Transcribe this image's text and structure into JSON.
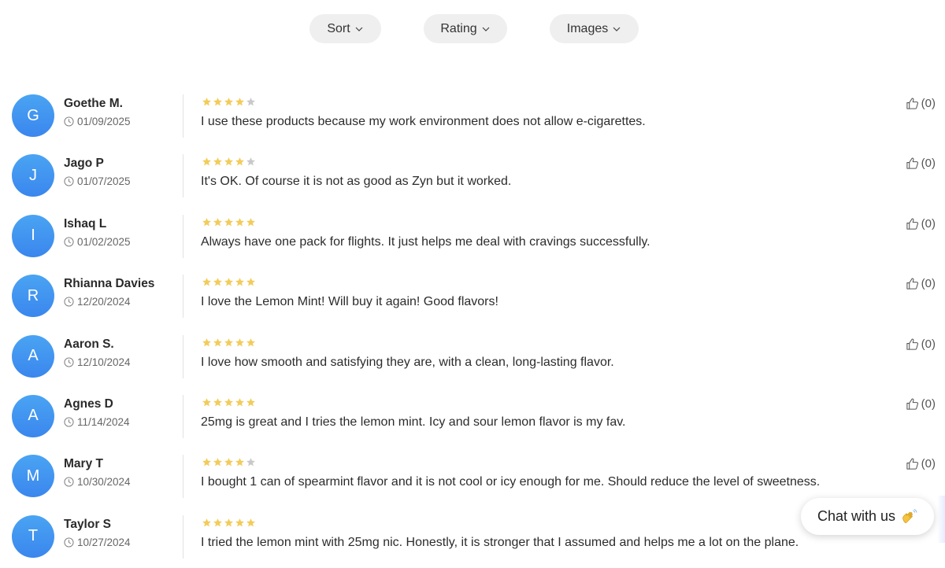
{
  "filters": {
    "sort_label": "Sort",
    "rating_label": "Rating",
    "images_label": "Images"
  },
  "colors": {
    "star_filled": "#f2cc5b",
    "star_empty": "#c9c9c9",
    "avatar_gradient_top": "#4aa4f2",
    "avatar_gradient_bottom": "#3a86ee"
  },
  "reviews": [
    {
      "initial": "G",
      "name": "Goethe M.",
      "date": "01/09/2025",
      "rating": 4,
      "text": "I use these products because my work environment does not allow e-cigarettes.",
      "likes": "(0)"
    },
    {
      "initial": "J",
      "name": "Jago P",
      "date": "01/07/2025",
      "rating": 4,
      "text": "It's OK. Of course it is not as good as Zyn but it worked.",
      "likes": "(0)"
    },
    {
      "initial": "I",
      "name": "Ishaq L",
      "date": "01/02/2025",
      "rating": 5,
      "text": "Always have one pack for flights. It just helps me deal with cravings successfully.",
      "likes": "(0)"
    },
    {
      "initial": "R",
      "name": "Rhianna Davies",
      "date": "12/20/2024",
      "rating": 5,
      "text": "I love the Lemon Mint! Will buy it again! Good flavors!",
      "likes": "(0)"
    },
    {
      "initial": "A",
      "name": "Aaron S.",
      "date": "12/10/2024",
      "rating": 5,
      "text": "I love how smooth and satisfying they are, with a clean, long-lasting flavor.",
      "likes": "(0)"
    },
    {
      "initial": "A",
      "name": "Agnes D",
      "date": "11/14/2024",
      "rating": 5,
      "text": "25mg is great and I tries the lemon mint. Icy and sour lemon flavor is my fav.",
      "likes": "(0)"
    },
    {
      "initial": "M",
      "name": "Mary T",
      "date": "10/30/2024",
      "rating": 4,
      "text": "I bought 1 can of spearmint flavor and it is not cool or icy enough for me. Should reduce the level of sweetness.",
      "likes": "(0)"
    },
    {
      "initial": "T",
      "name": "Taylor S",
      "date": "10/27/2024",
      "rating": 5,
      "text": "I tried the lemon mint with 25mg nic. Honestly, it is stronger that I assumed and helps me a lot on the plane.",
      "likes": ""
    }
  ],
  "chat": {
    "label": "Chat with us",
    "icon": "waving-hand-icon"
  }
}
